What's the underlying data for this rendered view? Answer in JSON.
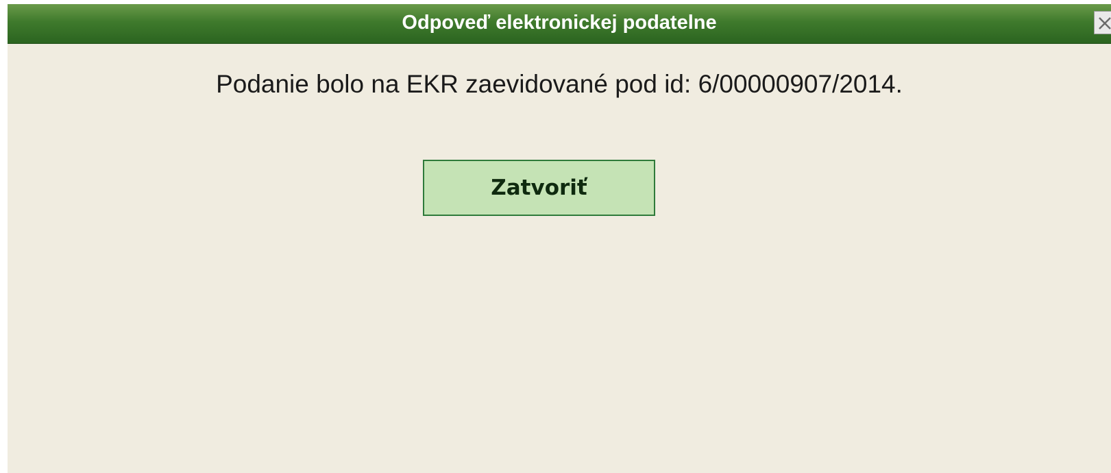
{
  "dialog": {
    "title": "Odpoveď elektronickej podatelne",
    "message": "Podanie bolo na EKR zaevidované pod id: 6/00000907/2014.",
    "close_button_label": "Zatvoriť",
    "close_icon": "close-icon"
  },
  "colors": {
    "titlebar": "#3f7a2c",
    "background": "#f0ece0",
    "button_fill": "#c5e3b5",
    "button_border": "#2e7a3a"
  }
}
